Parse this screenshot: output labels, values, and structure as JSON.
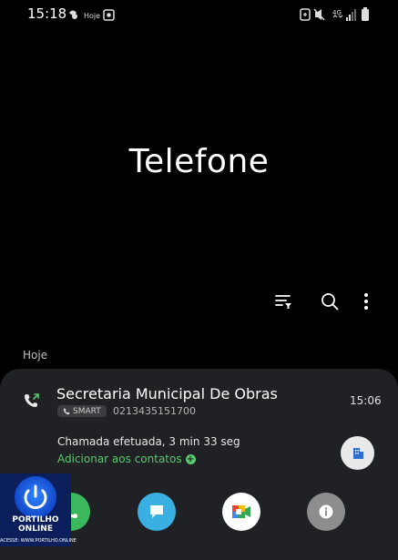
{
  "status_bar": {
    "time": "15:18",
    "notification_text": "Hoje",
    "network": "4G"
  },
  "screen_title": "Telefone",
  "toolbar": {
    "filter_icon": "filter-icon",
    "search_icon": "search-icon",
    "more_icon": "more-vertical-icon"
  },
  "section_label": "Hoje",
  "call_entry": {
    "name": "Secretaria Municipal De Obras",
    "badge_label": "SMART",
    "number": "0213435151700",
    "time": "15:06",
    "call_type": "Chamada efetuada, 3 min 33 seg",
    "add_contact": "Adicionar aos contatos"
  },
  "actions": {
    "call": "phone-icon",
    "message": "message-icon",
    "video": "video-call-icon",
    "info": "info-icon"
  },
  "colors": {
    "accent_green": "#5bc86f",
    "message_blue": "#3ab0e2",
    "info_gray": "#8d8d8d",
    "card_bg": "#1f2125"
  },
  "watermark": {
    "line1": "PORTILHO",
    "line2": "ONLINE",
    "line3": "ACESSE: WWW.PORTILHO.ONLINE"
  }
}
